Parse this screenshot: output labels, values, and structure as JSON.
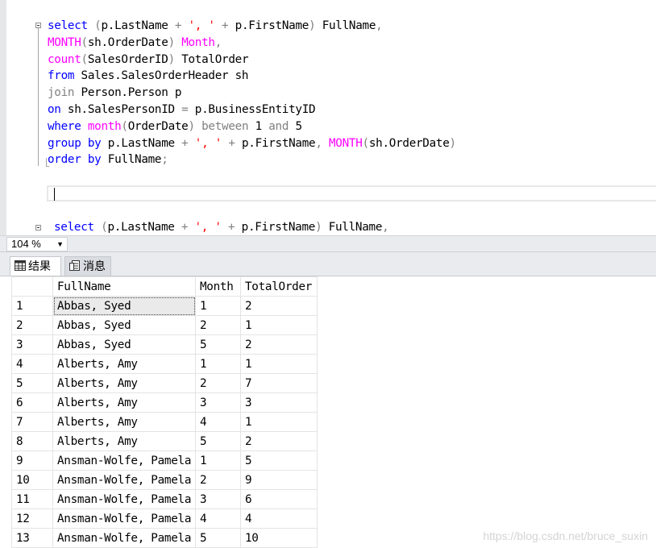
{
  "editor": {
    "lines": [
      {
        "tokens": [
          [
            "kw",
            "select"
          ],
          [
            "op",
            " ("
          ],
          [
            "id",
            "p.LastName "
          ],
          [
            "op",
            "+ "
          ],
          [
            "str",
            "', '"
          ],
          [
            "op",
            " + "
          ],
          [
            "id",
            "p.FirstName"
          ],
          [
            "op",
            ") "
          ],
          [
            "id",
            "FullName"
          ],
          [
            "op",
            ","
          ]
        ]
      },
      {
        "tokens": [
          [
            "fn",
            "MONTH"
          ],
          [
            "op",
            "("
          ],
          [
            "id",
            "sh.OrderDate"
          ],
          [
            "op",
            ") "
          ],
          [
            "fn",
            "Month"
          ],
          [
            "op",
            ","
          ]
        ]
      },
      {
        "tokens": [
          [
            "fn",
            "count"
          ],
          [
            "op",
            "("
          ],
          [
            "id",
            "SalesOrderID"
          ],
          [
            "op",
            ") "
          ],
          [
            "id",
            "TotalOrder"
          ]
        ]
      },
      {
        "tokens": [
          [
            "kw",
            "from"
          ],
          [
            "id",
            " Sales.SalesOrderHeader sh"
          ]
        ]
      },
      {
        "tokens": [
          [
            "op",
            "join"
          ],
          [
            "id",
            " Person.Person p"
          ]
        ]
      },
      {
        "tokens": [
          [
            "kw",
            "on"
          ],
          [
            "id",
            " sh.SalesPersonID "
          ],
          [
            "op",
            "="
          ],
          [
            "id",
            " p.BusinessEntityID"
          ]
        ]
      },
      {
        "tokens": [
          [
            "kw",
            "where"
          ],
          [
            "fn",
            " month"
          ],
          [
            "op",
            "("
          ],
          [
            "id",
            "OrderDate"
          ],
          [
            "op",
            ") between "
          ],
          [
            "id",
            "1 "
          ],
          [
            "op",
            "and "
          ],
          [
            "id",
            "5"
          ]
        ]
      },
      {
        "tokens": [
          [
            "kw",
            "group by"
          ],
          [
            "id",
            " p.LastName "
          ],
          [
            "op",
            "+ "
          ],
          [
            "str",
            "', '"
          ],
          [
            "op",
            " + "
          ],
          [
            "id",
            "p.FirstName"
          ],
          [
            "op",
            ", "
          ],
          [
            "fn",
            "MONTH"
          ],
          [
            "op",
            "("
          ],
          [
            "id",
            "sh.OrderDate"
          ],
          [
            "op",
            ")"
          ]
        ]
      },
      {
        "tokens": [
          [
            "kw",
            "order by"
          ],
          [
            "id",
            " FullName"
          ],
          [
            "op",
            ";"
          ]
        ]
      }
    ],
    "second_query": {
      "tokens": [
        [
          "kw",
          "select"
        ],
        [
          "op",
          " ("
        ],
        [
          "id",
          "p.LastName "
        ],
        [
          "op",
          "+ "
        ],
        [
          "str",
          "', '"
        ],
        [
          "op",
          " + "
        ],
        [
          "id",
          "p.FirstName"
        ],
        [
          "op",
          ") "
        ],
        [
          "id",
          "FullName"
        ],
        [
          "op",
          ","
        ]
      ]
    }
  },
  "zoom": {
    "value": "104 %",
    "arrow": "▼"
  },
  "tabs": {
    "results_label": "结果",
    "messages_label": "消息"
  },
  "grid": {
    "columns": [
      "FullName",
      "Month",
      "TotalOrder"
    ],
    "rows": [
      [
        "1",
        "Abbas, Syed",
        "1",
        "2"
      ],
      [
        "2",
        "Abbas, Syed",
        "2",
        "1"
      ],
      [
        "3",
        "Abbas, Syed",
        "5",
        "2"
      ],
      [
        "4",
        "Alberts, Amy",
        "1",
        "1"
      ],
      [
        "5",
        "Alberts, Amy",
        "2",
        "7"
      ],
      [
        "6",
        "Alberts, Amy",
        "3",
        "3"
      ],
      [
        "7",
        "Alberts, Amy",
        "4",
        "1"
      ],
      [
        "8",
        "Alberts, Amy",
        "5",
        "2"
      ],
      [
        "9",
        "Ansman-Wolfe, Pamela",
        "1",
        "5"
      ],
      [
        "10",
        "Ansman-Wolfe, Pamela",
        "2",
        "9"
      ],
      [
        "11",
        "Ansman-Wolfe, Pamela",
        "3",
        "6"
      ],
      [
        "12",
        "Ansman-Wolfe, Pamela",
        "4",
        "4"
      ],
      [
        "13",
        "Ansman-Wolfe, Pamela",
        "5",
        "10"
      ]
    ]
  },
  "watermark": "https://blog.csdn.net/bruce_suxin",
  "colors": {
    "keyword": "#0000ff",
    "function": "#ff00ff",
    "string": "#ff0000",
    "operator": "#808080"
  }
}
